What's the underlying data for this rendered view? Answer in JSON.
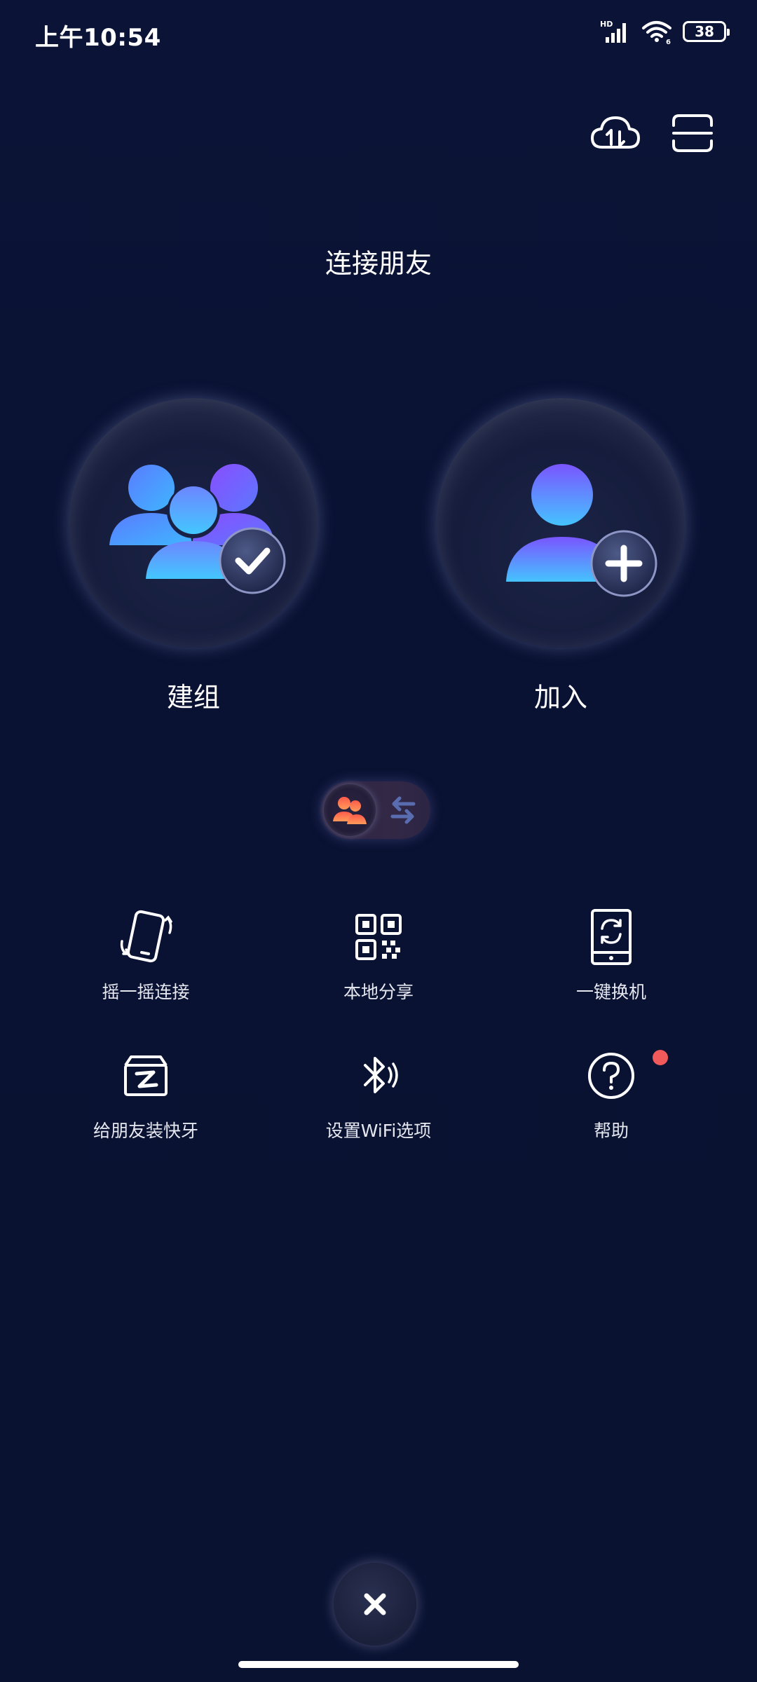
{
  "status_bar": {
    "time": "上午10:54",
    "network": "HD",
    "wifi_badge": "6",
    "battery": "38"
  },
  "top_tools": {
    "cloud_icon": "cloud-transfer-icon",
    "scan_icon": "scan-icon"
  },
  "title": "连接朋友",
  "actions": {
    "create": {
      "label": "建组",
      "icon": "group-check-icon"
    },
    "join": {
      "label": "加入",
      "icon": "user-add-icon"
    }
  },
  "switch": {
    "icon": "swap-arrows-icon"
  },
  "grid": [
    {
      "label": "摇一摇连接",
      "icon": "shake-phone-icon"
    },
    {
      "label": "本地分享",
      "icon": "qr-code-icon"
    },
    {
      "label": "一键换机",
      "icon": "phone-sync-icon"
    },
    {
      "label": "给朋友装快牙",
      "icon": "zapya-box-icon"
    },
    {
      "label": "设置WiFi选项",
      "icon": "bluetooth-signal-icon"
    },
    {
      "label": "帮助",
      "icon": "help-icon"
    }
  ],
  "colors": {
    "background": "#0a1233",
    "accent_blue": "#3fc0ff",
    "accent_purple": "#7a55ff",
    "notify_red": "#f05a5a"
  }
}
